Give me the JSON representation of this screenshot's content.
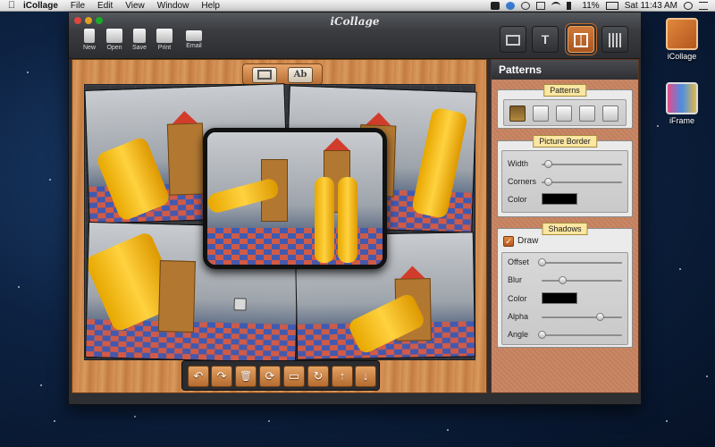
{
  "menubar": {
    "app_name": "iCollage",
    "menus": [
      "File",
      "Edit",
      "View",
      "Window",
      "Help"
    ],
    "battery": "11%",
    "clock": "Sat 11:43 AM"
  },
  "desktop": {
    "icons": [
      {
        "label": "iCollage",
        "icon": "icollage-app-icon"
      },
      {
        "label": "iFrame",
        "icon": "iframe-app-icon"
      }
    ]
  },
  "window": {
    "title": "iCollage",
    "toolbar": [
      {
        "label": "New",
        "icon": "new-document-icon"
      },
      {
        "label": "Open",
        "icon": "folder-icon"
      },
      {
        "label": "Save",
        "icon": "floppy-disk-icon"
      },
      {
        "label": "Print",
        "icon": "printer-icon"
      },
      {
        "label": "Email",
        "icon": "envelope-icon"
      }
    ],
    "modes": [
      {
        "icon": "photo-mode-icon",
        "text": ""
      },
      {
        "icon": "text-mode-icon",
        "text": "T"
      },
      {
        "icon": "patterns-mode-icon",
        "text": "",
        "active": true
      },
      {
        "icon": "brushes-mode-icon",
        "text": ""
      }
    ]
  },
  "canvas": {
    "add_buttons": [
      {
        "icon": "add-photo-icon",
        "text": ""
      },
      {
        "icon": "add-text-icon",
        "text": "Ab"
      }
    ],
    "bottom_toolbar": [
      {
        "icon": "undo-arrow-icon",
        "glyph": "↶"
      },
      {
        "icon": "redo-arrow-icon",
        "glyph": "↷"
      },
      {
        "icon": "trash-icon",
        "glyph": "🗑"
      },
      {
        "icon": "refresh-icon",
        "glyph": "⟳"
      },
      {
        "icon": "fit-frame-icon",
        "glyph": "▭"
      },
      {
        "icon": "rotate-icon",
        "glyph": "↻"
      },
      {
        "icon": "bring-forward-icon",
        "glyph": "↑"
      },
      {
        "icon": "send-backward-icon",
        "glyph": "↓"
      }
    ]
  },
  "panel": {
    "title": "Patterns",
    "patterns": {
      "label": "Patterns",
      "options": [
        "pattern-1-icon",
        "pattern-2-icon",
        "pattern-3-icon",
        "pattern-4-icon",
        "pattern-5-icon"
      ],
      "selected_index": 0
    },
    "picture_border": {
      "label": "Picture Border",
      "width_label": "Width",
      "width_value": 0.08,
      "corners_label": "Corners",
      "corners_value": 0.08,
      "color_label": "Color",
      "color_value": "#000000"
    },
    "shadows": {
      "label": "Shadows",
      "draw_label": "Draw",
      "draw_checked": true,
      "offset_label": "Offset",
      "offset_value": 0.0,
      "blur_label": "Blur",
      "blur_value": 0.25,
      "color_label": "Color",
      "color_value": "#000000",
      "alpha_label": "Alpha",
      "alpha_value": 0.72,
      "angle_label": "Angle",
      "angle_value": 0.0
    }
  },
  "colors": {
    "accent": "#c86a2a",
    "wood": "#d08e52",
    "section_label_bg": "#fbe7a1"
  }
}
